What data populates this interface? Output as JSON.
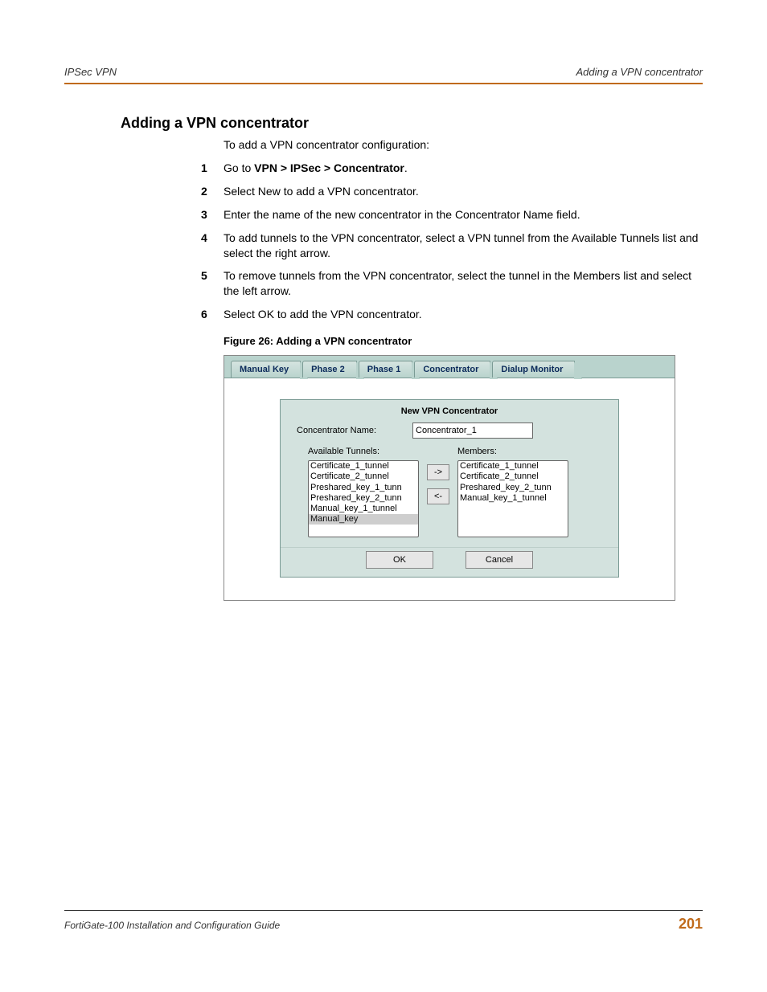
{
  "header": {
    "left": "IPSec VPN",
    "right": "Adding a VPN concentrator"
  },
  "section_title": "Adding a VPN concentrator",
  "intro": "To add a VPN concentrator configuration:",
  "steps": {
    "s1_pre": "Go to ",
    "s1_bold": "VPN > IPSec > Concentrator",
    "s1_post": ".",
    "s2": "Select New to add a VPN concentrator.",
    "s3": "Enter the name of the new concentrator in the Concentrator Name field.",
    "s4": "To add tunnels to the VPN concentrator, select a VPN tunnel from the Available Tunnels list and select the right arrow.",
    "s5": "To remove tunnels from the VPN concentrator, select the tunnel in the Members list and select the left arrow.",
    "s6": "Select OK to add the VPN concentrator."
  },
  "figure_caption": "Figure 26: Adding a VPN concentrator",
  "tabs": {
    "manual": "Manual Key",
    "phase2": "Phase 2",
    "phase1": "Phase 1",
    "concentrator": "Concentrator",
    "dialup": "Dialup Monitor"
  },
  "panel": {
    "title": "New VPN Concentrator",
    "name_label": "Concentrator Name:",
    "name_value": "Concentrator_1",
    "available_label": "Available Tunnels:",
    "members_label": "Members:",
    "available": [
      "Certificate_1_tunnel",
      "Certificate_2_tunnel",
      "Preshared_key_1_tunn",
      "Preshared_key_2_tunn",
      "Manual_key_1_tunnel",
      "Manual_key"
    ],
    "members": [
      "Certificate_1_tunnel",
      "Certificate_2_tunnel",
      "Preshared_key_2_tunn",
      "Manual_key_1_tunnel"
    ],
    "arrow_right": "->",
    "arrow_left": "<-",
    "ok": "OK",
    "cancel": "Cancel"
  },
  "footer": {
    "guide": "FortiGate-100 Installation and Configuration Guide",
    "page": "201"
  }
}
